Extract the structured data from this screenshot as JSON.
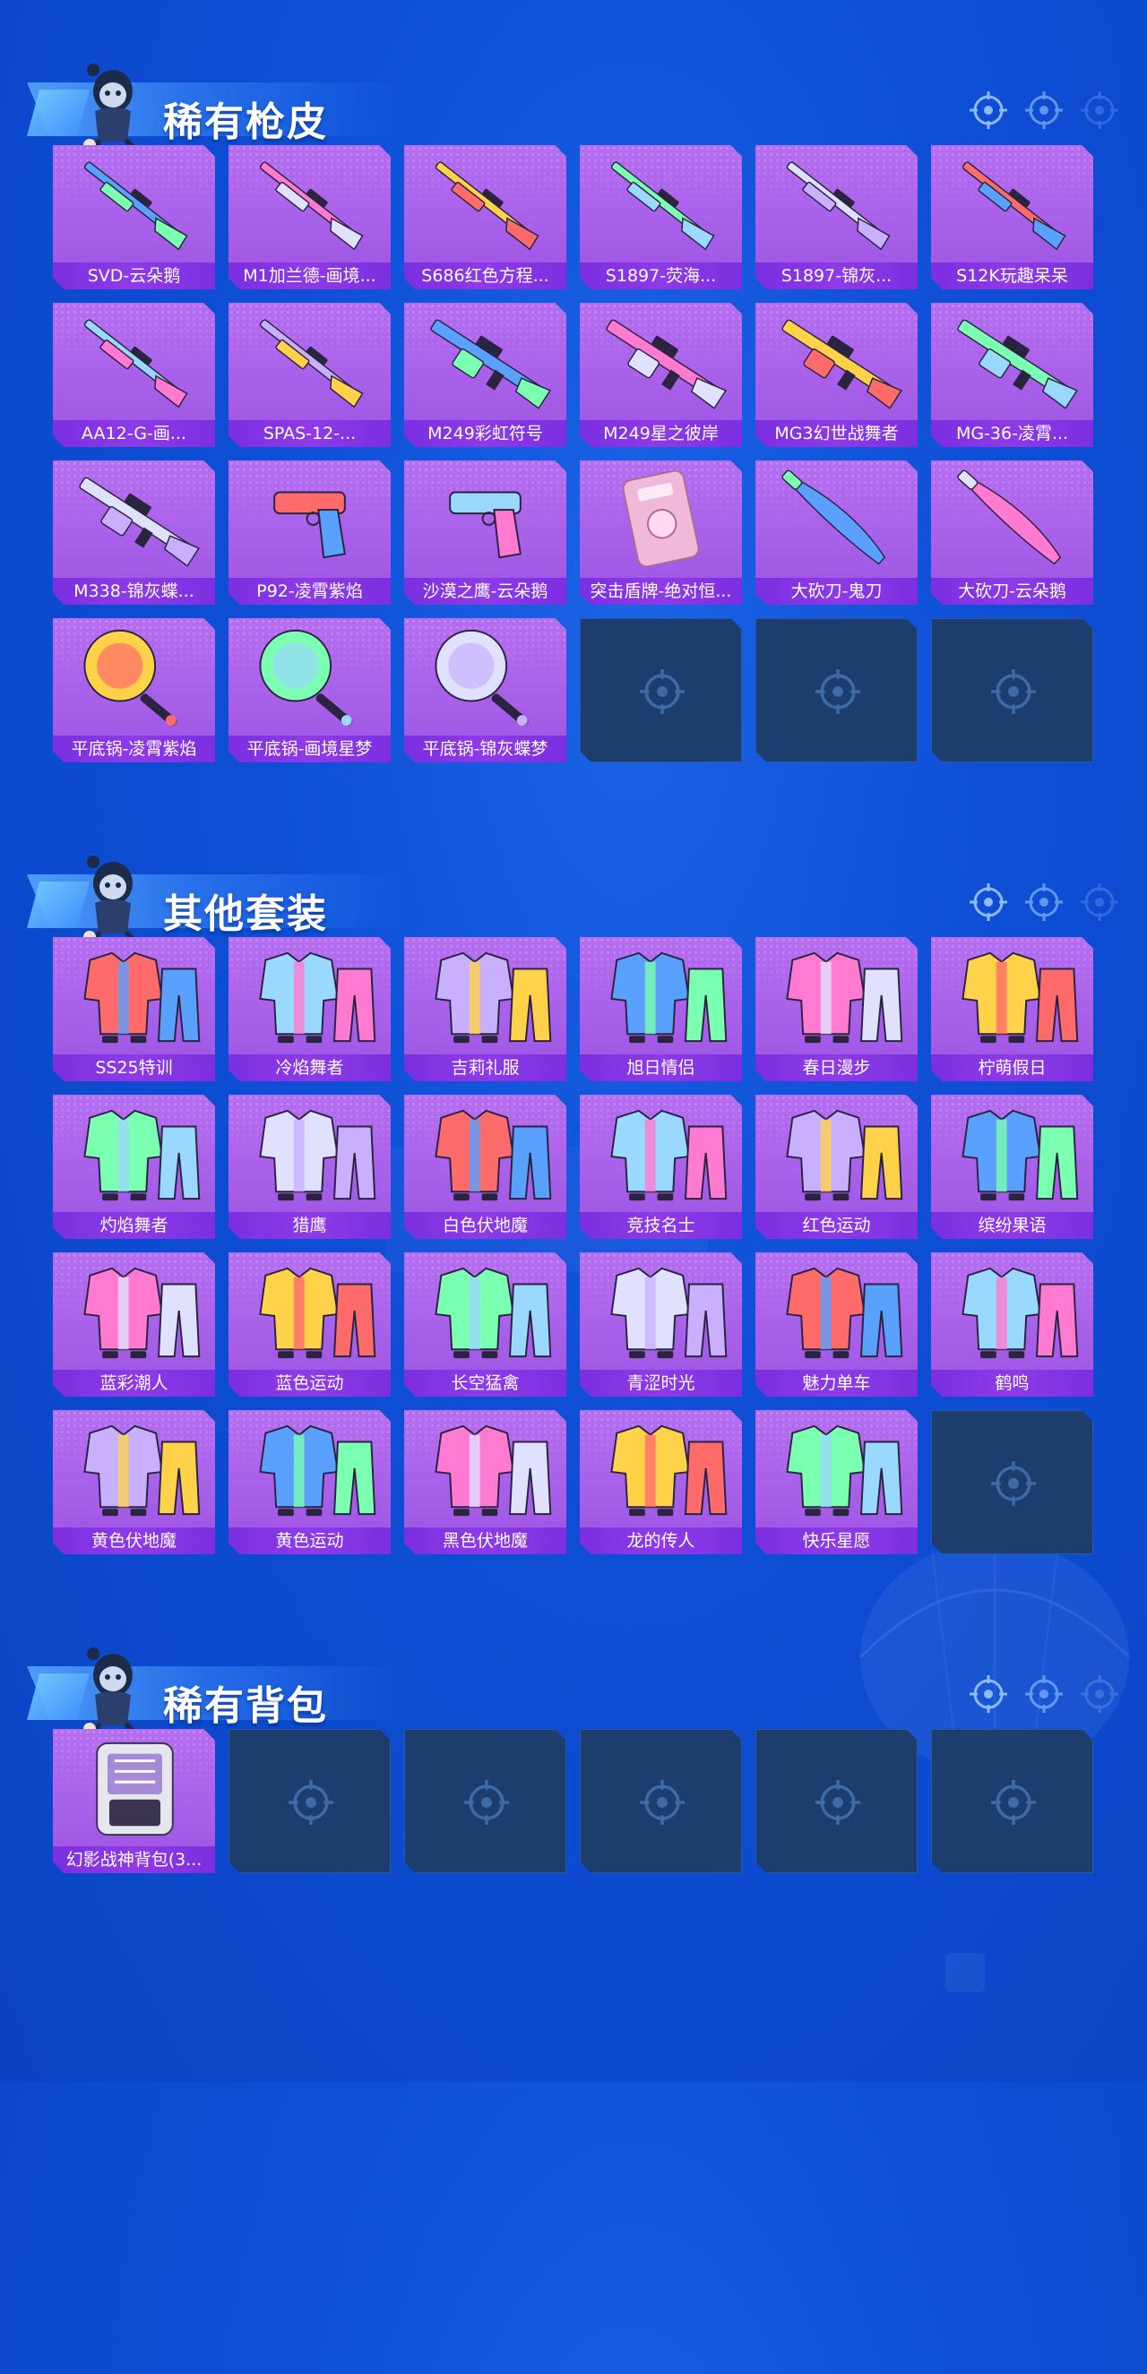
{
  "colors": {
    "background": "#0e4fd6",
    "card_bg": "#b56ef0",
    "label_bg": "#8f3ae8",
    "empty_bg": "#1c3d6e",
    "title_text": "#ffffff"
  },
  "sections": [
    {
      "title": "稀有枪皮",
      "items": [
        {
          "label": "SVD-云朵鹅",
          "icon": "rifle-icon"
        },
        {
          "label": "M1加兰德-画境...",
          "icon": "rifle-icon"
        },
        {
          "label": "S686红色方程...",
          "icon": "shotgun-icon"
        },
        {
          "label": "S1897-荧海...",
          "icon": "shotgun-icon"
        },
        {
          "label": "S1897-锦灰...",
          "icon": "shotgun-icon"
        },
        {
          "label": "S12K玩趣呆呆",
          "icon": "shotgun-icon"
        },
        {
          "label": "AA12-G-画...",
          "icon": "shotgun-icon"
        },
        {
          "label": "SPAS-12-...",
          "icon": "shotgun-icon"
        },
        {
          "label": "M249彩虹符号",
          "icon": "machine-gun-icon"
        },
        {
          "label": "M249星之彼岸",
          "icon": "machine-gun-icon"
        },
        {
          "label": "MG3幻世战舞者",
          "icon": "machine-gun-icon"
        },
        {
          "label": "MG-36-凌霄...",
          "icon": "machine-gun-icon"
        },
        {
          "label": "M338-锦灰蝶...",
          "icon": "machine-gun-icon"
        },
        {
          "label": "P92-凌霄紫焰",
          "icon": "pistol-icon"
        },
        {
          "label": "沙漠之鹰-云朵鹅",
          "icon": "pistol-icon"
        },
        {
          "label": "突击盾牌-绝对恒...",
          "icon": "shield-icon"
        },
        {
          "label": "大砍刀-鬼刀",
          "icon": "machete-icon"
        },
        {
          "label": "大砍刀-云朵鹅",
          "icon": "machete-icon"
        },
        {
          "label": "平底锅-凌霄紫焰",
          "icon": "pan-icon"
        },
        {
          "label": "平底锅-画境星梦",
          "icon": "pan-icon"
        },
        {
          "label": "平底锅-锦灰蝶梦",
          "icon": "pan-icon"
        }
      ],
      "empty_slots": 3
    },
    {
      "title": "其他套装",
      "items": [
        {
          "label": "SS25特训",
          "icon": "outfit-icon"
        },
        {
          "label": "冷焰舞者",
          "icon": "outfit-icon"
        },
        {
          "label": "吉莉礼服",
          "icon": "outfit-icon"
        },
        {
          "label": "旭日情侣",
          "icon": "outfit-icon"
        },
        {
          "label": "春日漫步",
          "icon": "outfit-icon"
        },
        {
          "label": "柠萌假日",
          "icon": "outfit-icon"
        },
        {
          "label": "灼焰舞者",
          "icon": "outfit-icon"
        },
        {
          "label": "猎鹰",
          "icon": "outfit-icon"
        },
        {
          "label": "白色伏地魔",
          "icon": "outfit-icon"
        },
        {
          "label": "竞技名士",
          "icon": "outfit-icon"
        },
        {
          "label": "红色运动",
          "icon": "outfit-icon"
        },
        {
          "label": "缤纷果语",
          "icon": "outfit-icon"
        },
        {
          "label": "蓝彩潮人",
          "icon": "outfit-icon"
        },
        {
          "label": "蓝色运动",
          "icon": "outfit-icon"
        },
        {
          "label": "长空猛禽",
          "icon": "outfit-icon"
        },
        {
          "label": "青涩时光",
          "icon": "outfit-icon"
        },
        {
          "label": "魅力单车",
          "icon": "outfit-icon"
        },
        {
          "label": "鹤鸣",
          "icon": "outfit-icon"
        },
        {
          "label": "黄色伏地魔",
          "icon": "outfit-icon"
        },
        {
          "label": "黄色运动",
          "icon": "outfit-icon"
        },
        {
          "label": "黑色伏地魔",
          "icon": "outfit-icon"
        },
        {
          "label": "龙的传人",
          "icon": "outfit-icon"
        },
        {
          "label": "快乐星愿",
          "icon": "outfit-icon"
        }
      ],
      "empty_slots": 1
    },
    {
      "title": "稀有背包",
      "items": [
        {
          "label": "幻影战神背包(3...",
          "icon": "backpack-icon"
        }
      ],
      "empty_slots": 5
    }
  ]
}
